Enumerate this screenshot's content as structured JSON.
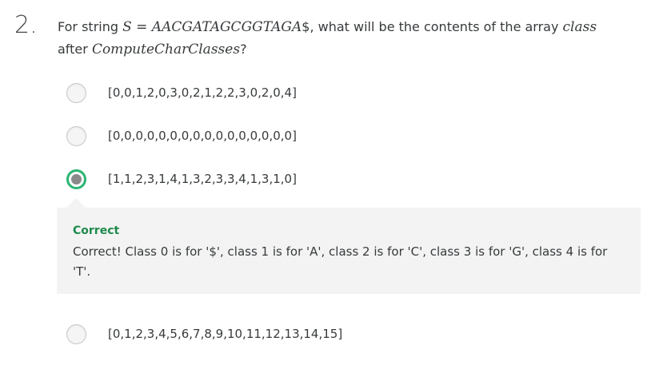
{
  "question": {
    "number": "2.",
    "prompt_prefix": "For string ",
    "string_math": "S = AACGATAGCGGTAGA",
    "prompt_middle": "$, what will be the contents of the array ",
    "array_math": "class",
    "prompt_after": "after ",
    "function_math": "ComputeCharClasses",
    "prompt_suffix": "?"
  },
  "options": [
    {
      "label": "[0,0,1,2,0,3,0,2,1,2,2,3,0,2,0,4]",
      "selected": false
    },
    {
      "label": "[0,0,0,0,0,0,0,0,0,0,0,0,0,0,0,0]",
      "selected": false
    },
    {
      "label": "[1,1,2,3,1,4,1,3,2,3,3,4,1,3,1,0]",
      "selected": true
    },
    {
      "label": "[0,1,2,3,4,5,6,7,8,9,10,11,12,13,14,15]",
      "selected": false
    }
  ],
  "feedback": {
    "title": "Correct",
    "text": "Correct! Class 0 is for '$', class 1 is for 'A', class 2 is for 'C', class 3 is for 'G', class 4 is for 'T'."
  },
  "colors": {
    "correct_green": "#2bb673",
    "feedback_title": "#1f8a4c",
    "feedback_bg": "#f3f3f3"
  }
}
